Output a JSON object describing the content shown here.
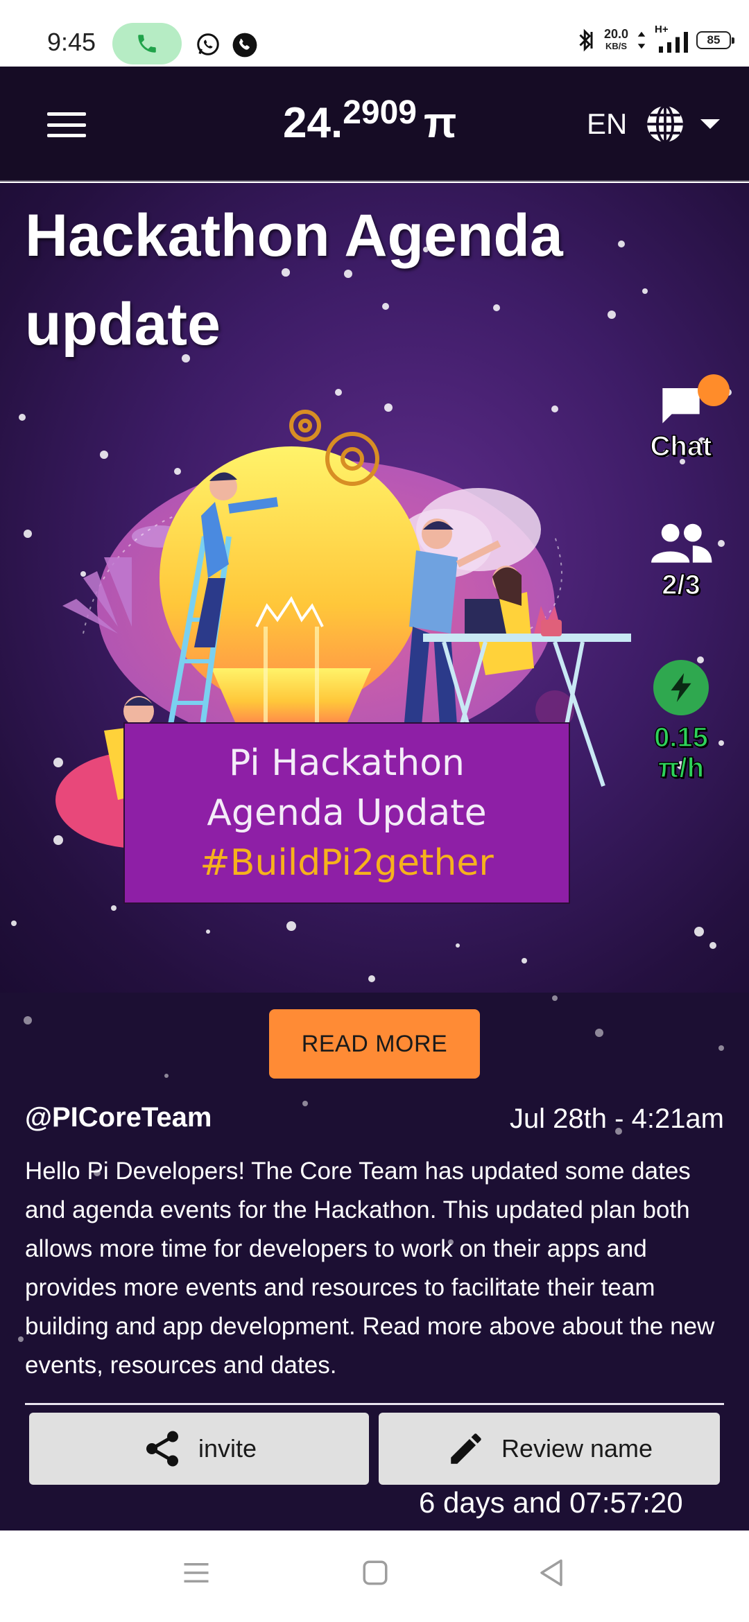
{
  "status_bar": {
    "time": "9:45",
    "net_speed": "20.0",
    "net_unit": "KB/S",
    "network_type": "H+",
    "battery": "85"
  },
  "header": {
    "balance_int": "24.",
    "balance_dec": "2909",
    "currency": "π",
    "language": "EN"
  },
  "hero": {
    "title": "Hackathon Agenda update",
    "banner_line1": "Pi Hackathon",
    "banner_line2": "Agenda Update",
    "banner_tag": "#BuildPi2gether"
  },
  "side": {
    "chat_label": "Chat",
    "team_count": "2/3",
    "rate_value": "0.15",
    "rate_unit": "π/h"
  },
  "post": {
    "read_more_label": "READ MORE",
    "author": "@PICoreTeam",
    "date": "Jul 28th - 4:21am",
    "body": "Hello Pi Developers! The Core Team has updated some dates and agenda events for the Hackathon. This updated plan both allows more time for developers to work on their apps and provides more events and resources to facilitate their team building and app development. Read more above about the new events, resources and dates."
  },
  "actions": {
    "invite_label": "invite",
    "review_label": "Review name",
    "countdown": "6 days and 07:57:20"
  },
  "colors": {
    "header_bg": "#160c25",
    "accent_orange": "#ff8b35",
    "banner_purple": "#8e1fa6",
    "mining_green": "#2fa84f"
  }
}
